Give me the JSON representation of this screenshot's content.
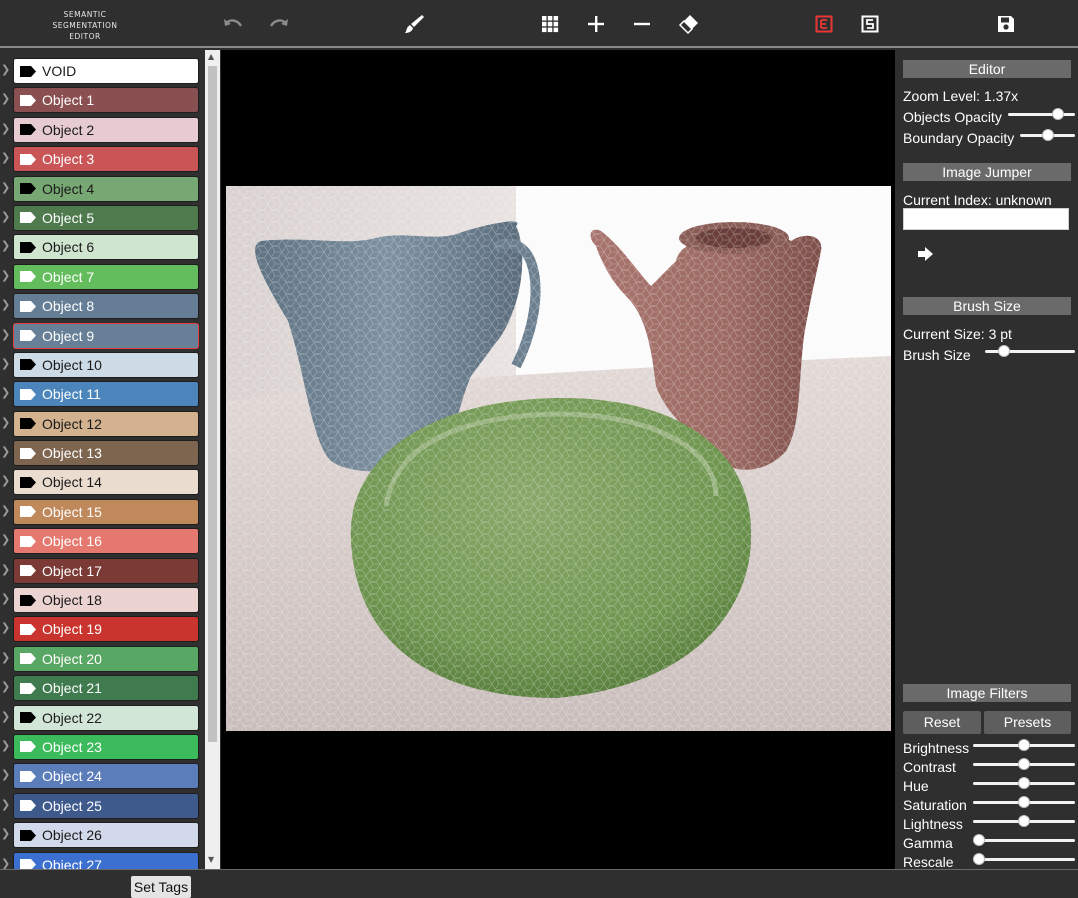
{
  "app": {
    "brand_line1": "SEMANTIC",
    "brand_line2": "SEGMENTATION",
    "brand_line3": "EDITOR"
  },
  "toolbar": {
    "icons": [
      "undo-icon",
      "redo-icon",
      "brush-icon",
      "superpixel-grid-icon",
      "zoom-in-icon",
      "zoom-out-icon",
      "eraser-icon",
      "letter-e-icon",
      "letter-s-icon",
      "save-icon"
    ],
    "active_color": "#e53935"
  },
  "labels": [
    {
      "name": "VOID",
      "color": "#ffffff",
      "light_text": false
    },
    {
      "name": "Object 1",
      "color": "#8a4f51",
      "light_text": true
    },
    {
      "name": "Object 2",
      "color": "#e6cbd0",
      "light_text": false
    },
    {
      "name": "Object 3",
      "color": "#c95556",
      "light_text": true
    },
    {
      "name": "Object 4",
      "color": "#77a772",
      "light_text": false
    },
    {
      "name": "Object 5",
      "color": "#4f7a4e",
      "light_text": true
    },
    {
      "name": "Object 6",
      "color": "#cfe5d0",
      "light_text": false
    },
    {
      "name": "Object 7",
      "color": "#64bd5d",
      "light_text": true
    },
    {
      "name": "Object 8",
      "color": "#657e95",
      "light_text": true
    },
    {
      "name": "Object 9",
      "color": "#677f97",
      "light_text": true,
      "selected": true
    },
    {
      "name": "Object 10",
      "color": "#ccdbe6",
      "light_text": false
    },
    {
      "name": "Object 11",
      "color": "#4b85bb",
      "light_text": true
    },
    {
      "name": "Object 12",
      "color": "#d2b28f",
      "light_text": false
    },
    {
      "name": "Object 13",
      "color": "#7e6550",
      "light_text": true
    },
    {
      "name": "Object 14",
      "color": "#ebdcd0",
      "light_text": false
    },
    {
      "name": "Object 15",
      "color": "#c0895b",
      "light_text": true
    },
    {
      "name": "Object 16",
      "color": "#e5796f",
      "light_text": true
    },
    {
      "name": "Object 17",
      "color": "#7b3a36",
      "light_text": true
    },
    {
      "name": "Object 18",
      "color": "#ebd3d2",
      "light_text": false
    },
    {
      "name": "Object 19",
      "color": "#c9342e",
      "light_text": true
    },
    {
      "name": "Object 20",
      "color": "#59a764",
      "light_text": true
    },
    {
      "name": "Object 21",
      "color": "#3f7b4f",
      "light_text": true
    },
    {
      "name": "Object 22",
      "color": "#d1e6d6",
      "light_text": false
    },
    {
      "name": "Object 23",
      "color": "#3cbb5c",
      "light_text": true
    },
    {
      "name": "Object 24",
      "color": "#5b7ebb",
      "light_text": true
    },
    {
      "name": "Object 25",
      "color": "#3e5a8c",
      "light_text": true
    },
    {
      "name": "Object 26",
      "color": "#d2d9ea",
      "light_text": false
    },
    {
      "name": "Object 27",
      "color": "#3b6fd0",
      "light_text": true
    }
  ],
  "panel": {
    "editor_title": "Editor",
    "zoom_text": "Zoom Level: 1.37x",
    "objects_opacity_label": "Objects Opacity",
    "objects_opacity_value": 0.8,
    "boundary_opacity_label": "Boundary Opacity",
    "boundary_opacity_value": 0.5,
    "jumper_title": "Image Jumper",
    "current_index_text": "Current Index: unknown",
    "jump_input_value": "",
    "brush_title": "Brush Size",
    "current_size_text": "Current Size: 3 pt",
    "brush_size_label": "Brush Size",
    "brush_size_value": 0.17,
    "filters_title": "Image Filters",
    "reset_label": "Reset",
    "presets_label": "Presets",
    "filters": [
      {
        "name": "Brightness",
        "value": 0.5
      },
      {
        "name": "Contrast",
        "value": 0.5
      },
      {
        "name": "Hue",
        "value": 0.5
      },
      {
        "name": "Saturation",
        "value": 0.5
      },
      {
        "name": "Lightness",
        "value": 0.5
      },
      {
        "name": "Gamma",
        "value": 0.0
      },
      {
        "name": "Rescale",
        "value": 0.0
      }
    ]
  },
  "bottom": {
    "set_tags_label": "Set Tags"
  }
}
